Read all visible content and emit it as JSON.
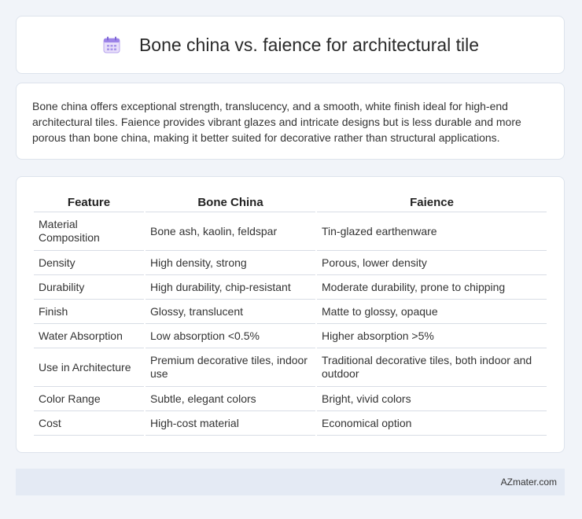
{
  "header": {
    "title": "Bone china vs. faience for architectural tile",
    "icon": "calendar-icon"
  },
  "summary": {
    "text": "Bone china offers exceptional strength, translucency, and a smooth, white finish ideal for high-end architectural tiles. Faience provides vibrant glazes and intricate designs but is less durable and more porous than bone china, making it better suited for decorative rather than structural applications."
  },
  "table": {
    "headers": [
      "Feature",
      "Bone China",
      "Faience"
    ],
    "rows": [
      [
        "Material Composition",
        "Bone ash, kaolin, feldspar",
        "Tin-glazed earthenware"
      ],
      [
        "Density",
        "High density, strong",
        "Porous, lower density"
      ],
      [
        "Durability",
        "High durability, chip-resistant",
        "Moderate durability, prone to chipping"
      ],
      [
        "Finish",
        "Glossy, translucent",
        "Matte to glossy, opaque"
      ],
      [
        "Water Absorption",
        "Low absorption <0.5%",
        "Higher absorption >5%"
      ],
      [
        "Use in Architecture",
        "Premium decorative tiles, indoor use",
        "Traditional decorative tiles, both indoor and outdoor"
      ],
      [
        "Color Range",
        "Subtle, elegant colors",
        "Bright, vivid colors"
      ],
      [
        "Cost",
        "High-cost material",
        "Economical option"
      ]
    ]
  },
  "footer": {
    "brand": "AZmater.com"
  }
}
